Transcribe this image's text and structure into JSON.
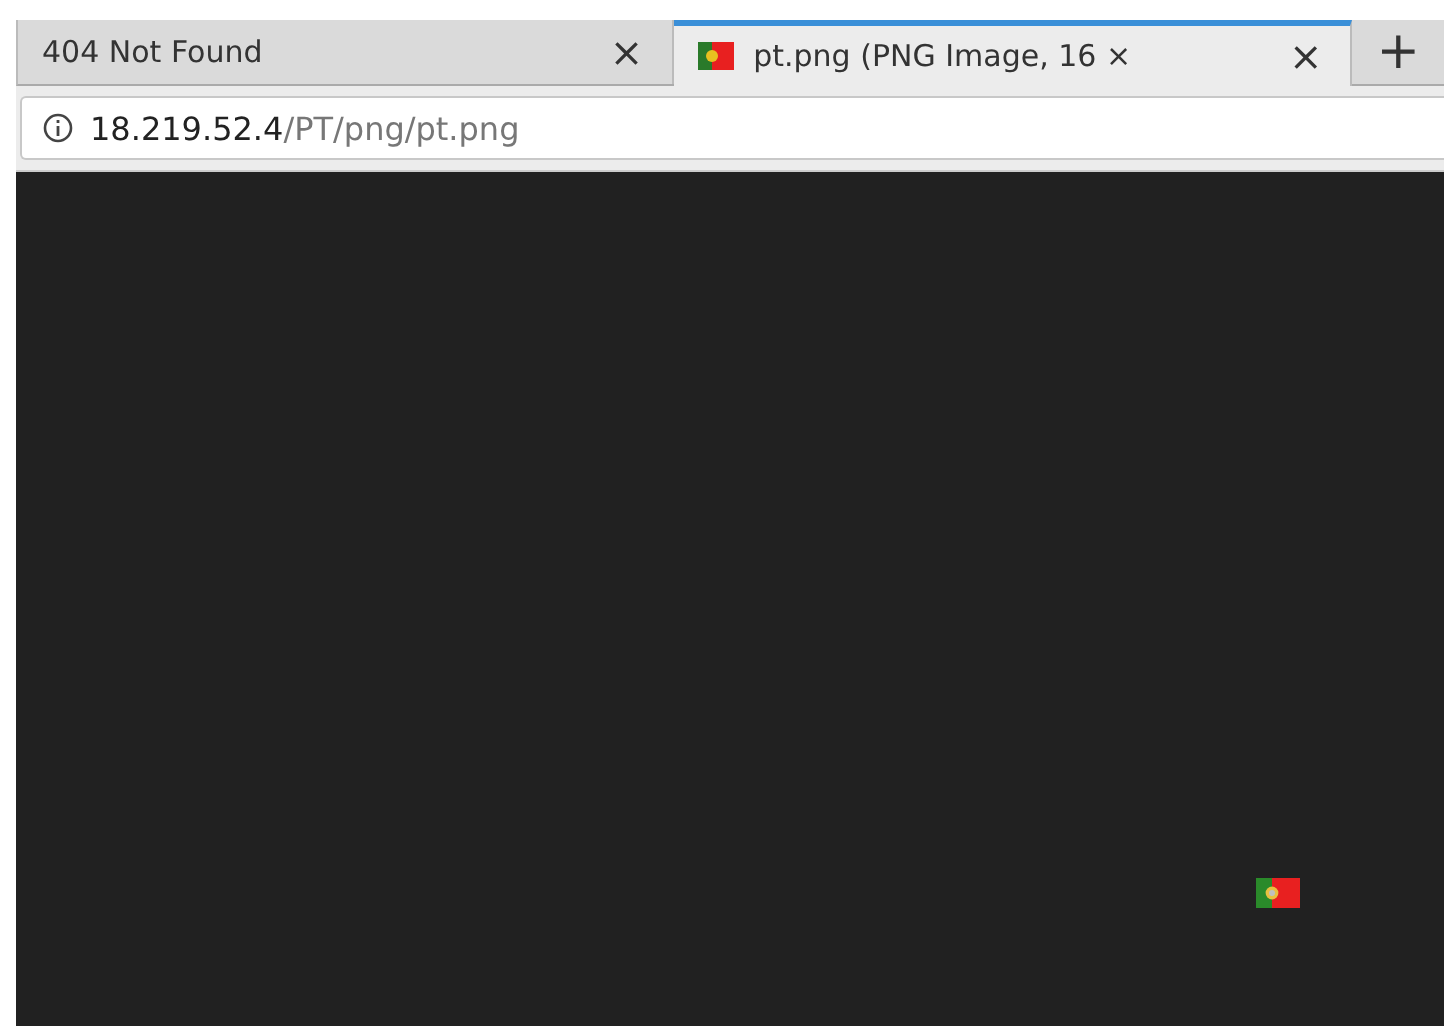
{
  "tabs": [
    {
      "title": "404 Not Found",
      "close": "×",
      "selected": false,
      "favicon": false
    },
    {
      "title": "pt.png (PNG Image, 16 ×",
      "close": "×",
      "selected": true,
      "favicon": true
    }
  ],
  "new_tab": "+",
  "address_bar": {
    "host": "18.219.52.4",
    "path": "/PT/png/pt.png"
  }
}
